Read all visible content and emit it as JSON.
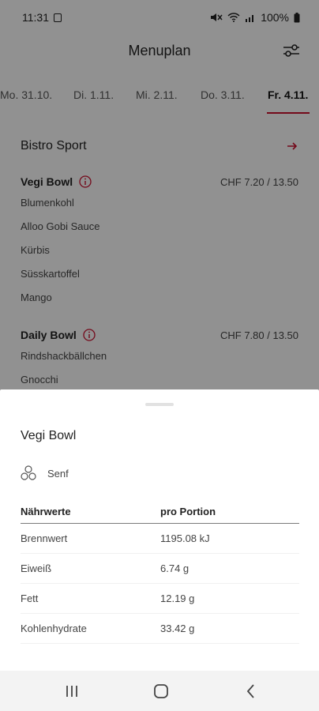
{
  "status_bar": {
    "time": "11:31",
    "battery": "100%"
  },
  "app_bar": {
    "title": "Menuplan"
  },
  "tabs": [
    {
      "label": "Mo. 31.10."
    },
    {
      "label": "Di. 1.11."
    },
    {
      "label": "Mi. 2.11."
    },
    {
      "label": "Do. 3.11."
    },
    {
      "label": "Fr. 4.11.",
      "active": true
    }
  ],
  "restaurant": {
    "name": "Bistro Sport"
  },
  "menus": [
    {
      "name": "Vegi Bowl",
      "price": "CHF 7.20 / 13.50",
      "ingredients": [
        "Blumenkohl",
        "Alloo Gobi Sauce",
        "Kürbis",
        "Süsskartoffel",
        "Mango"
      ]
    },
    {
      "name": "Daily Bowl",
      "price": "CHF 7.80 / 13.50",
      "ingredients": [
        "Rindshackbällchen",
        "Gnocchi"
      ]
    }
  ],
  "sheet": {
    "title": "Vegi Bowl",
    "allergen": "Senf",
    "table_headers": [
      "Nährwerte",
      "pro Portion"
    ],
    "rows": [
      {
        "label": "Brennwert",
        "value": "1195.08 kJ"
      },
      {
        "label": "Eiweiß",
        "value": "6.74 g"
      },
      {
        "label": "Fett",
        "value": "12.19 g"
      },
      {
        "label": "Kohlenhydrate",
        "value": "33.42 g"
      }
    ]
  },
  "colors": {
    "accent": "#c8102e",
    "overlay": "rgba(0,0,0,0.42)"
  },
  "icons": {
    "filter": "filter-sliders-icon",
    "arrow": "arrow-right-icon",
    "info": "info-circle-icon",
    "allergen": "allergen-mustard-icon"
  }
}
